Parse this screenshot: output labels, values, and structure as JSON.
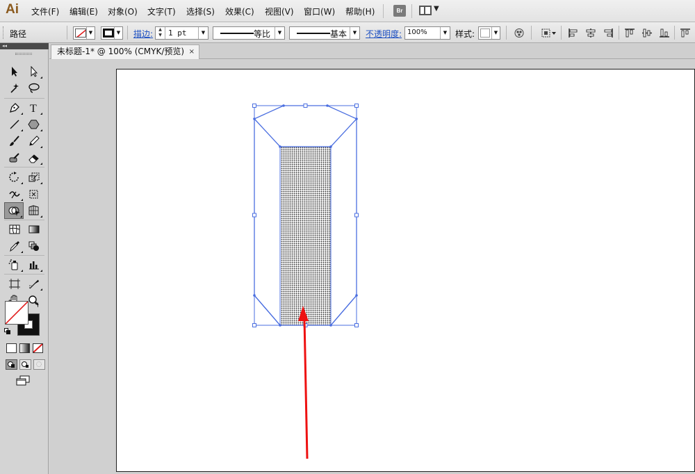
{
  "app": {
    "logo": "Ai"
  },
  "menu": [
    {
      "label": "文件(F)"
    },
    {
      "label": "编辑(E)"
    },
    {
      "label": "对象(O)"
    },
    {
      "label": "文字(T)"
    },
    {
      "label": "选择(S)"
    },
    {
      "label": "效果(C)"
    },
    {
      "label": "视图(V)"
    },
    {
      "label": "窗口(W)"
    },
    {
      "label": "帮助(H)"
    }
  ],
  "menubar_buttons": {
    "bridge": "Br",
    "workspace_icon": "workspace-switcher-icon"
  },
  "control": {
    "selection_type": "路径",
    "stroke_label": "描边:",
    "stroke_weight": "1 pt",
    "variable_width": "等比",
    "brush_definition": "基本",
    "opacity_label": "不透明度:",
    "opacity_value": "100%",
    "style_label": "样式:",
    "icons": [
      "recolor-artwork-icon",
      "align-to-icon",
      "align-left-icon",
      "align-hcenter-icon",
      "align-right-icon",
      "align-top-icon",
      "align-vcenter-icon",
      "align-bottom-icon"
    ]
  },
  "document": {
    "tab_title": "未标题-1* @ 100% (CMYK/预览)",
    "close": "×"
  },
  "tools": [
    "selection-tool",
    "direct-selection-tool",
    "magic-wand-tool",
    "lasso-tool",
    "pen-tool",
    "type-tool",
    "line-tool",
    "polygon-tool",
    "paintbrush-tool",
    "pencil-tool",
    "blob-brush-tool",
    "eraser-tool",
    "rotate-tool",
    "scale-tool",
    "width-tool",
    "free-transform-tool",
    "shape-builder-tool",
    "perspective-grid-tool",
    "mesh-tool",
    "gradient-tool",
    "eyedropper-tool",
    "blend-tool",
    "symbol-sprayer-tool",
    "graph-tool",
    "artboard-tool",
    "slice-tool",
    "hand-tool",
    "zoom-tool"
  ],
  "colors": {
    "selection": "#4a6ee0",
    "annotation_arrow": "#ee1111",
    "ui_link": "#1c4fc2",
    "logo": "#8b5a1e"
  }
}
